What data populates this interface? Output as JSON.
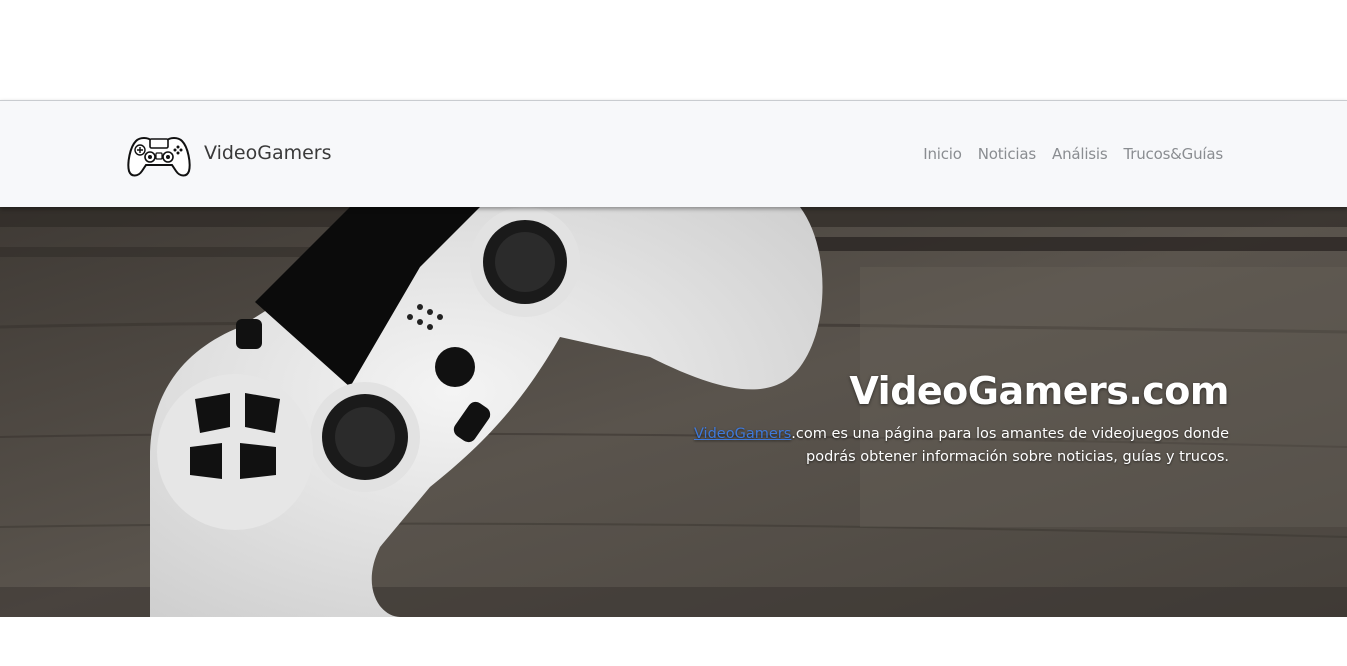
{
  "navbar": {
    "brand": "VideoGamers",
    "brand_icon": "gamepad-icon",
    "links": [
      "Inicio",
      "Noticias",
      "Análisis",
      "Trucos&Guías"
    ]
  },
  "hero": {
    "title": "VideoGamers.com",
    "link_text": "VideoGamers",
    "desc_line1_rest": ".com es una página para los amantes de videojuegos donde",
    "desc_line2": "podrás obtener información sobre noticias, guías y trucos.",
    "background": "white-gamepad-on-wood"
  },
  "colors": {
    "navbar_bg": "#f7f8fa",
    "nav_link": "#8a8d91",
    "link": "#3f79d9",
    "hero_text": "#ffffff"
  }
}
